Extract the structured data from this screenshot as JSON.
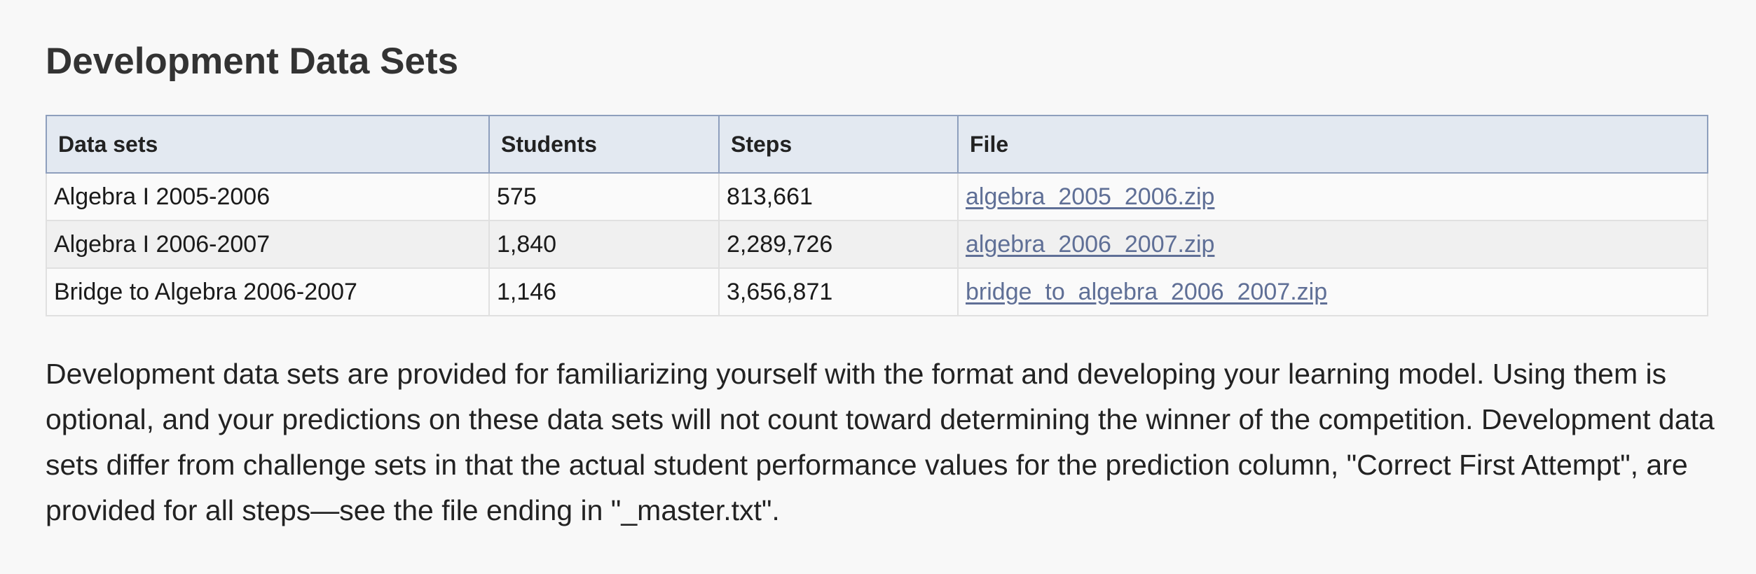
{
  "heading": "Development Data Sets",
  "table": {
    "headers": [
      "Data sets",
      "Students",
      "Steps",
      "File"
    ],
    "rows": [
      {
        "name": "Algebra I 2005-2006",
        "students": "575",
        "steps": "813,661",
        "file": "algebra_2005_2006.zip"
      },
      {
        "name": "Algebra I 2006-2007",
        "students": "1,840",
        "steps": "2,289,726",
        "file": "algebra_2006_2007.zip"
      },
      {
        "name": "Bridge to Algebra 2006-2007",
        "students": "1,146",
        "steps": "3,656,871",
        "file": "bridge_to_algebra_2006_2007.zip"
      }
    ]
  },
  "description": "Development data sets are provided for familiarizing yourself with the format and developing your learning model. Using them is optional, and your predictions on these data sets will not count toward determining the winner of the competition. Development data sets differ from challenge sets in that the actual student performance values for the prediction column, \"Correct First Attempt\", are provided for all steps—see the file ending in \"_master.txt\".",
  "colors": {
    "background": "#f8f8f8",
    "header_bg": "#e3e9f1",
    "header_border": "#8e9fbd",
    "link": "#5f6f96"
  }
}
